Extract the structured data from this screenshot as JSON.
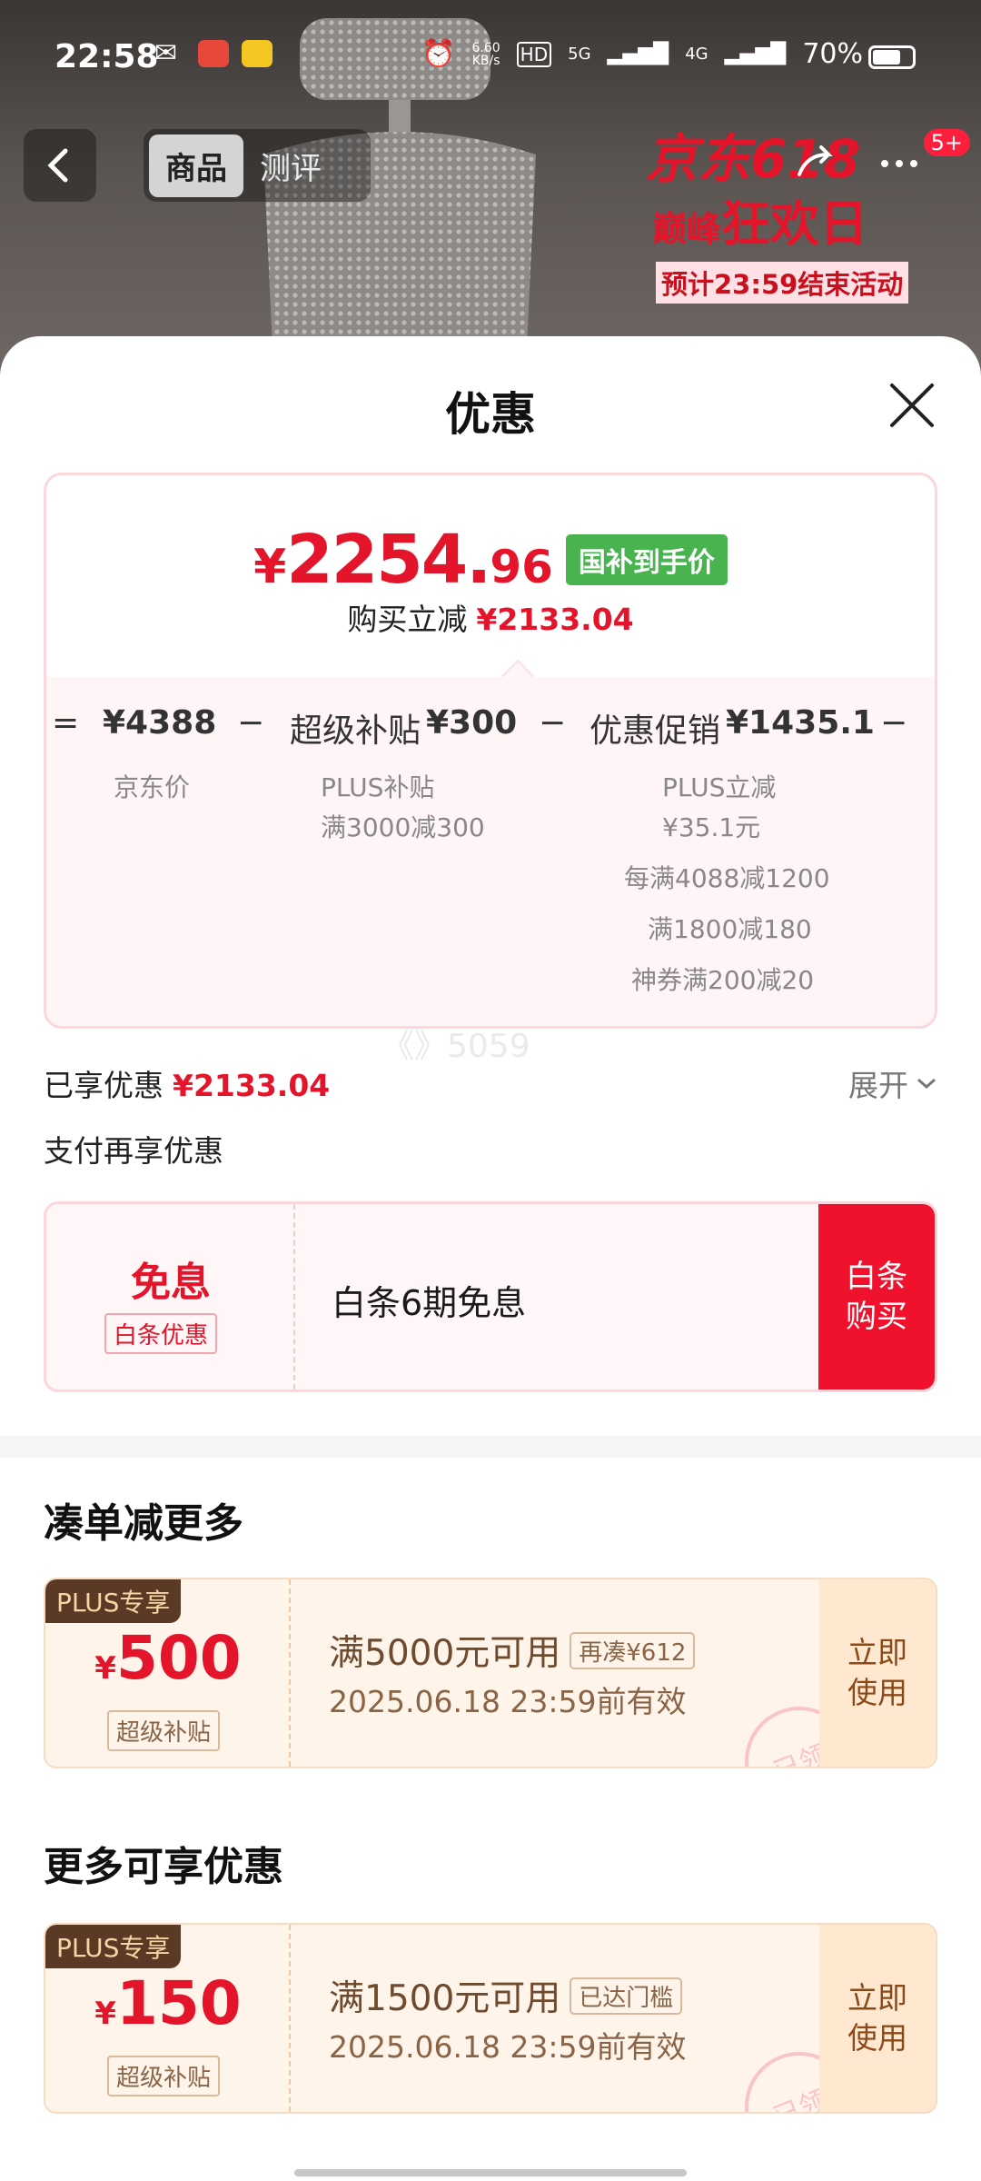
{
  "status_bar": {
    "time": "22:58",
    "speed_value": "6.60",
    "speed_unit": "KB/s",
    "hd": "HD",
    "net1": "5G",
    "net2": "4G",
    "battery": "70%"
  },
  "top_nav": {
    "tabs": [
      "商品",
      "测评"
    ],
    "badge": "5+"
  },
  "promo_banner": {
    "line1": "京东618",
    "line2a": "巅峰",
    "line2b": "狂欢日",
    "line3": "预计23:59结束活动"
  },
  "sheet": {
    "title": "优惠",
    "summary": {
      "price_symbol": "¥",
      "price_int": "2254.",
      "price_dec": "96",
      "tag": "国补到手价",
      "save_label": "购买立减",
      "save_value": "¥2133.04",
      "formula": {
        "eq": "=",
        "base_value": "¥4388",
        "minus": "−",
        "subsidy_label": "超级补贴",
        "subsidy_value": "¥300",
        "promo_label": "优惠促销",
        "promo_value": "¥1435.1",
        "trailing": "−"
      },
      "base_sub": "京东价",
      "subsidy_sub": [
        "PLUS补贴",
        "满3000减300"
      ],
      "promo_sub": [
        "PLUS立减",
        "¥35.1元",
        "每满4088减1200",
        "满1800减180",
        "神券满200减20"
      ]
    },
    "watermark": "《》5059",
    "enjoyed_label": "已享优惠",
    "enjoyed_value": "¥2133.04",
    "expand": "展开",
    "pay_more": "支付再享优惠",
    "baitiao": {
      "big": "免息",
      "tag": "白条优惠",
      "text": "白条6期免息",
      "button": "白条\n购买"
    },
    "section1_title": "凑单减更多",
    "section2_title": "更多可享优惠",
    "coupons": [
      {
        "plus_tag": "PLUS专享",
        "symbol": "¥",
        "amount": "500",
        "sub": "超级补贴",
        "condition": "满5000元可用",
        "badge": "再凑¥612",
        "validity": "2025.06.18 23:59前有效",
        "button": "立即\n使用",
        "stamp": "已领"
      },
      {
        "plus_tag": "PLUS专享",
        "symbol": "¥",
        "amount": "150",
        "sub": "超级补贴",
        "condition": "满1500元可用",
        "badge": "已达门槛",
        "validity": "2025.06.18 23:59前有效",
        "button": "立即\n使用",
        "stamp": "已领"
      }
    ]
  },
  "colors": {
    "accent_red": "#e4142a",
    "green_tag": "#48b34f",
    "plus_brown": "#5b3a25"
  }
}
